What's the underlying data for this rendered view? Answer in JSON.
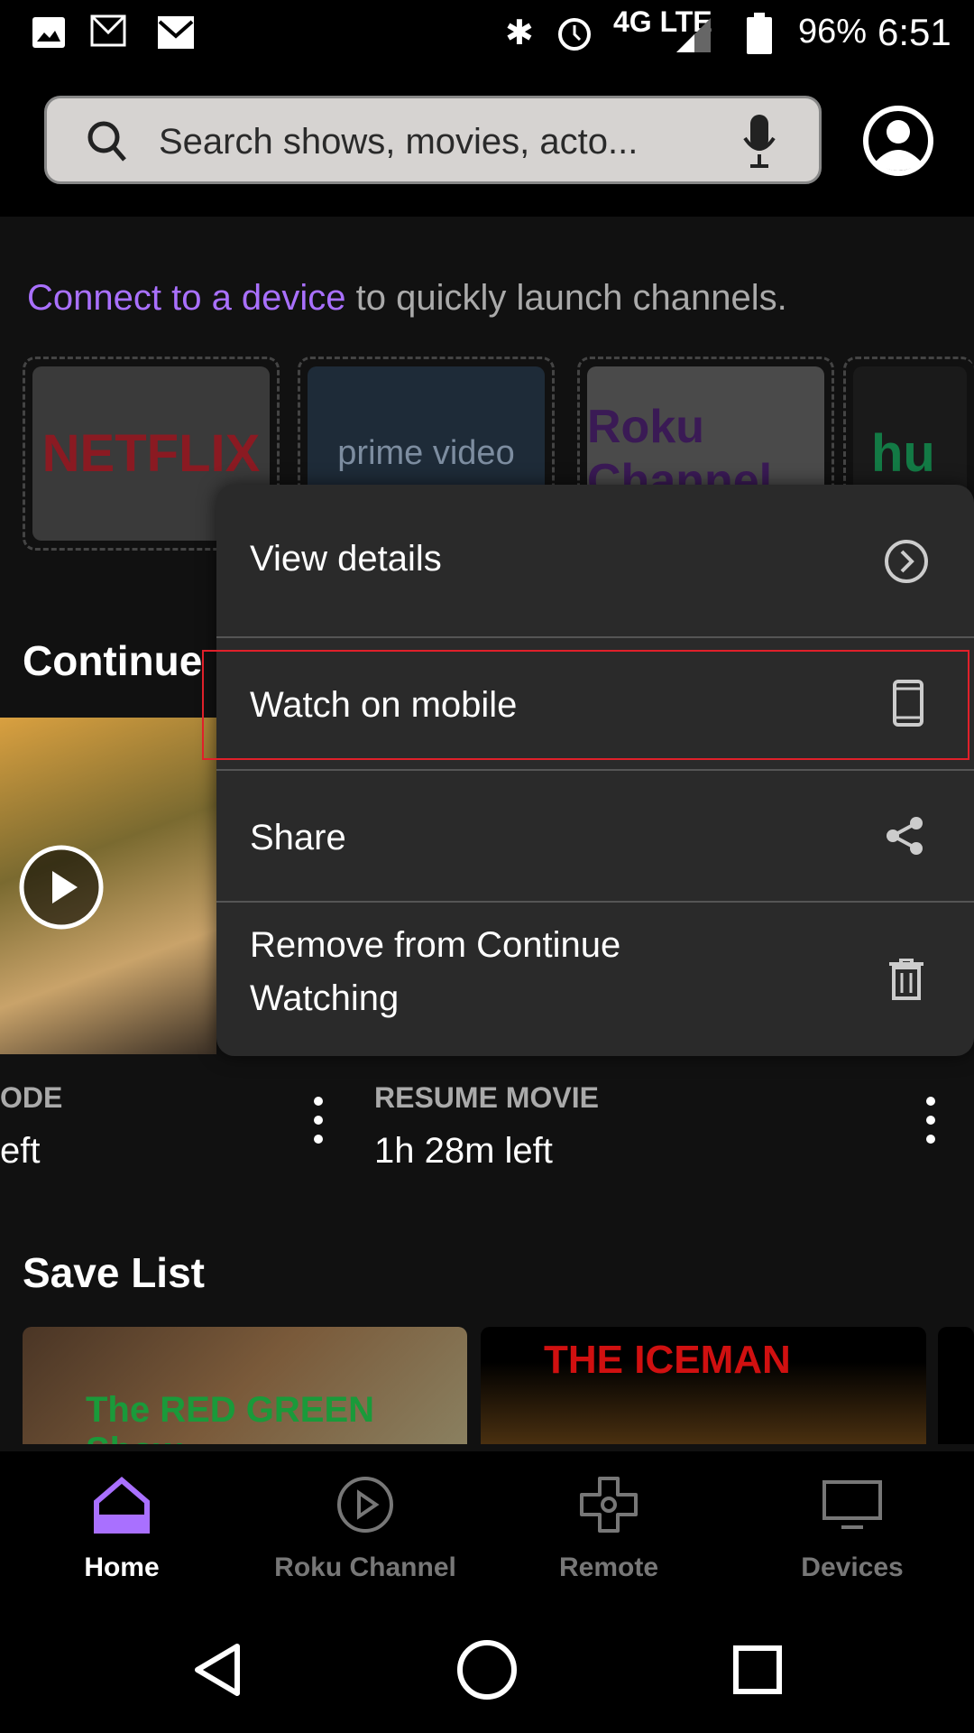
{
  "status_bar": {
    "battery": "96%",
    "time": "6:51",
    "network": "4G LTE"
  },
  "header": {
    "search_placeholder": "Search shows, movies, acto..."
  },
  "connect": {
    "link": "Connect to a device",
    "rest": " to quickly launch channels."
  },
  "channels": [
    {
      "name": "NETFLIX",
      "color": "#c8102e"
    },
    {
      "name": "prime video",
      "color": "#8aa0b8"
    },
    {
      "name": "Roku Channel",
      "color": "#5a2a82"
    },
    {
      "name": "hu",
      "color": "#1ce783"
    }
  ],
  "continue_watching": {
    "title": "Continue",
    "cards": [
      {
        "label": "ODE",
        "time": "eft"
      },
      {
        "label": "RESUME MOVIE",
        "time": "1h 28m left"
      }
    ]
  },
  "menu": {
    "items": [
      {
        "label": "View details",
        "icon": "chevron-right-circle-icon"
      },
      {
        "label": "Watch on mobile",
        "icon": "phone-icon",
        "highlighted": true
      },
      {
        "label": "Share",
        "icon": "share-icon"
      },
      {
        "label": "Remove from Continue Watching",
        "icon": "trash-icon"
      }
    ]
  },
  "save_list": {
    "title": "Save List",
    "posters": [
      {
        "title": "The RED GREEN Show"
      },
      {
        "title": "THE ICEMAN"
      }
    ]
  },
  "bottom_nav": {
    "active": "Home",
    "accent": "#a970ff",
    "items": [
      {
        "label": "Home"
      },
      {
        "label": "Roku Channel"
      },
      {
        "label": "Remote"
      },
      {
        "label": "Devices"
      }
    ]
  }
}
